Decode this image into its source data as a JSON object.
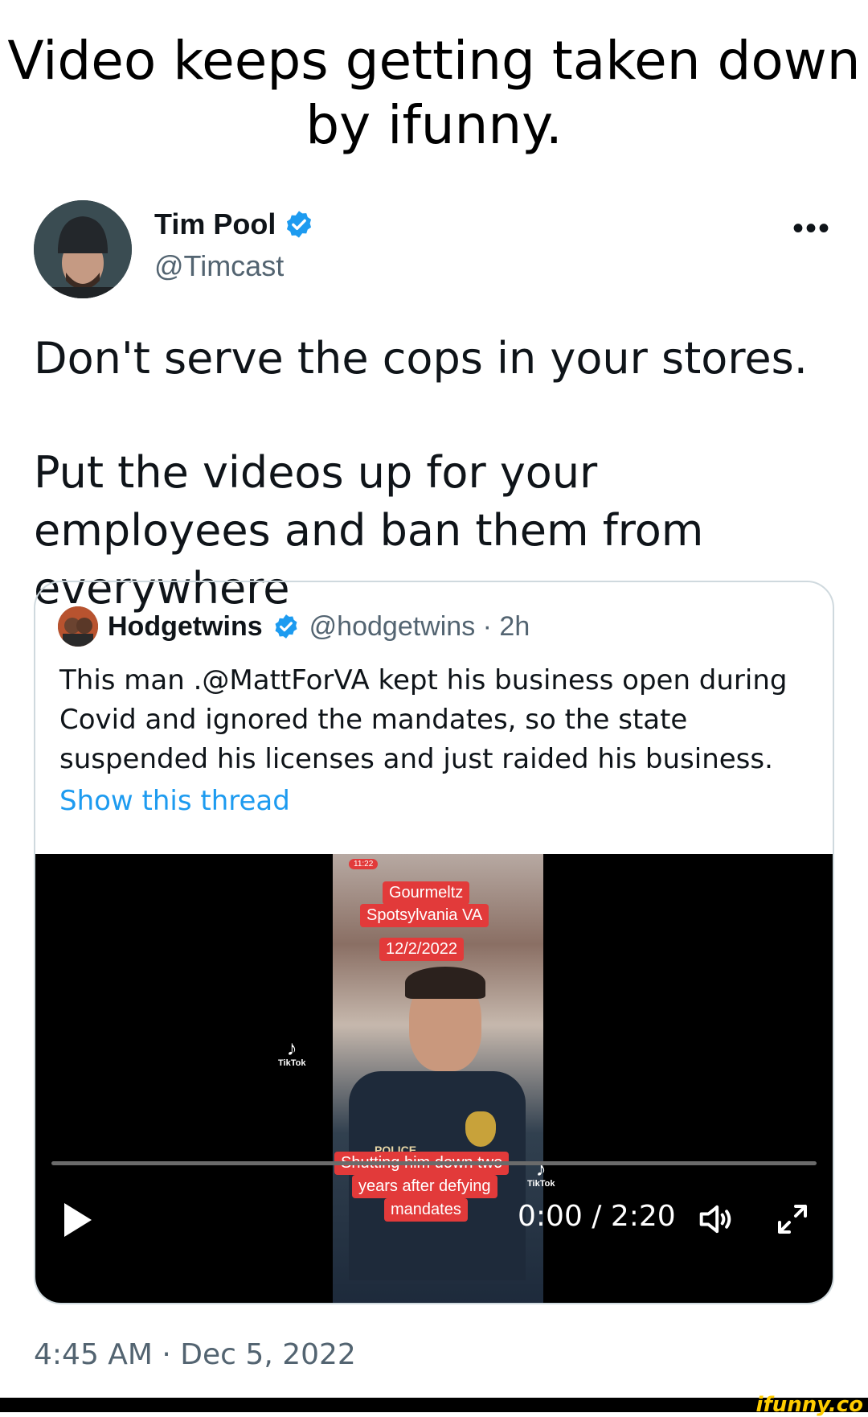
{
  "caption": "Video keeps getting taken down by ifunny.",
  "tweet": {
    "author_name": "Tim Pool",
    "author_handle": "@Timcast",
    "more_label": "•••",
    "paragraph_1": "Don't serve the cops in your stores.",
    "paragraph_2": "Put the videos up for your employees and ban them from everywhere",
    "timestamp": "4:45 AM · Dec 5, 2022"
  },
  "quote": {
    "author_name": "Hodgetwins",
    "author_handle": "@hodgetwins · 2h",
    "body": "This man .@MattForVA kept his business open during Covid and ignored the mandates, so the state suspended his licenses and just raided his business.",
    "show_thread": "Show this thread"
  },
  "video": {
    "overlay_status_time": "11:22",
    "overlay_title_1": "Gourmeltz",
    "overlay_title_2": "Spotsylvania VA",
    "overlay_date": "12/2/2022",
    "overlay_caption_1": "Shutting him down two",
    "overlay_caption_2": "years after defying",
    "overlay_caption_3": "mandates",
    "police_text": "POLICE",
    "tiktok_label": "TikTok",
    "time_readout": "0:00 / 2:20",
    "progress": 0
  },
  "watermark": "ifunny.co",
  "colors": {
    "link": "#1d9bf0",
    "secondary_text": "#536471",
    "verified": "#1d9bf0",
    "overlay_red": "#e23a3a",
    "watermark": "#ffcc00"
  },
  "icons": [
    "verified-badge-icon",
    "more-icon",
    "play-icon",
    "volume-icon",
    "fullscreen-icon",
    "tiktok-icon"
  ]
}
